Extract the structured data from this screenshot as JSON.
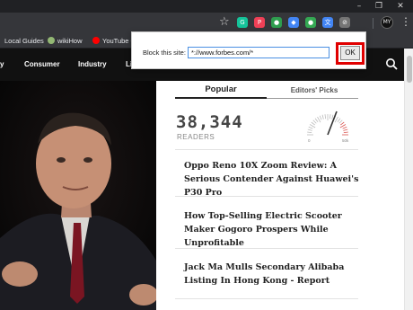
{
  "window": {
    "minimize_glyph": "–",
    "restore_glyph": "❐",
    "close_glyph": "✕"
  },
  "toolbar": {
    "extensions": [
      {
        "name": "grammarly-icon",
        "color": "#15c39a",
        "glyph": "G"
      },
      {
        "name": "pocket-icon",
        "color": "#ef4056",
        "glyph": "P"
      },
      {
        "name": "green-extension-icon",
        "color": "#2e9d4e",
        "glyph": "●"
      },
      {
        "name": "blue-extension-icon",
        "color": "#4285f4",
        "glyph": "◆"
      },
      {
        "name": "chat-extension-icon",
        "color": "#34a853",
        "glyph": "●"
      },
      {
        "name": "translate-extension-icon",
        "color": "#4285f4",
        "glyph": "文"
      },
      {
        "name": "block-site-icon",
        "color": "#757575",
        "glyph": "⊘"
      }
    ],
    "profile_initials": "MY"
  },
  "bookmarks": [
    {
      "label": "Local Guides",
      "icon": "local-guides-icon",
      "color": "#fbbc04"
    },
    {
      "label": "wikiHow",
      "icon": "wikihow-icon",
      "color": "#93b874"
    },
    {
      "label": "YouTube C",
      "icon": "youtube-icon",
      "color": "#ff0000"
    }
  ],
  "site_nav": {
    "items": [
      "Consumer",
      "Industry",
      "Li"
    ]
  },
  "sidebar": {
    "tabs": {
      "popular": "Popular",
      "editors": "Editors' Picks"
    },
    "readers_count": "38,344",
    "readers_label": "READERS",
    "gauge": {
      "min_label": "0",
      "max_label": "50k"
    },
    "articles": [
      "Oppo Reno 10X Zoom Review: A Serious Contender Against Huawei's P30 Pro",
      "How Top-Selling Electric Scooter Maker Gogoro Prospers While Unprofitable",
      "Jack Ma Mulls Secondary Alibaba Listing In Hong Kong - Report"
    ]
  },
  "popup": {
    "label": "Block this site:",
    "input_value": "*://www.forbes.com/*",
    "ok_label": "OK"
  },
  "colors": {
    "highlight_box": "#e00000",
    "nav_background": "#111111",
    "browser_chrome": "#35363a"
  }
}
